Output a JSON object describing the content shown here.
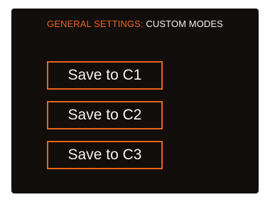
{
  "header": {
    "category": "GENERAL SETTINGS:",
    "page": "CUSTOM MODES"
  },
  "buttons": [
    {
      "label": "Save to C1"
    },
    {
      "label": "Save to C2"
    },
    {
      "label": "Save to C3"
    }
  ],
  "colors": {
    "accent": "#e8641e",
    "background": "#120e0c",
    "text": "#f2f2f2"
  }
}
